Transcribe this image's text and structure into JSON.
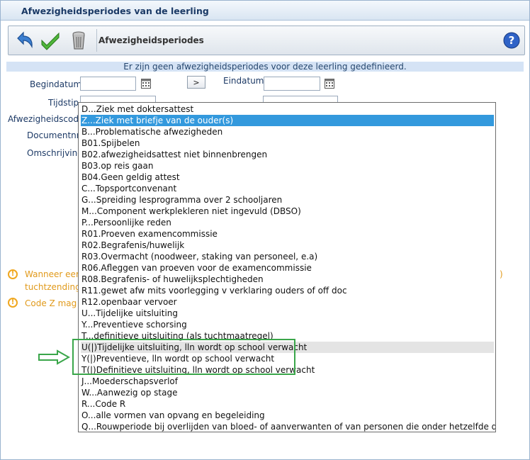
{
  "window": {
    "title": "Afwezigheidsperiodes van de leerling"
  },
  "toolbar": {
    "title": "Afwezigheidsperiodes",
    "icons": [
      "undo-icon",
      "checkmark-icon",
      "trash-icon",
      "help-icon"
    ]
  },
  "notice": "Er zijn geen afwezigheidsperiodes voor deze leerling gedefinieerd.",
  "form": {
    "begindatum_label": "Begindatum",
    "einddatum_label": "Eindatum",
    "range_button": ">",
    "tijdstip_label": "Tijdstip",
    "afwezigheidscode_label": "Afwezigheidscode",
    "documentnr_label": "Documentnr.",
    "omschrijving_label": "Omschrijving"
  },
  "warnings": {
    "line1": "Wanneer eer",
    "line1b": "tuchtzending",
    "line1_right": ")",
    "line2": "Code Z mag"
  },
  "dropdown": {
    "selected_index": 1,
    "hover_index": 21,
    "items": [
      "D...Ziek met doktersattest",
      "Z...Ziek met briefje van de ouder(s)",
      "B...Problematische afwezigheden",
      "B01.Spijbelen",
      "B02.afwezigheidsattest niet binnenbrengen",
      "B03.op reis gaan",
      "B04.Geen geldig attest",
      "C...Topsportconvenant",
      "G...Spreiding lesprogramma over 2 schooljaren",
      "M...Component werkplekleren niet ingevuld (DBSO)",
      "P...Persoonlijke reden",
      "R01.Proeven examencommissie",
      "R02.Begrafenis/huwelijk",
      "R03.Overmacht (noodweer, staking van personeel, e.a)",
      "R06.Afleggen van proeven voor de examencommissie",
      "R08.Begrafenis- of huwelijksplechtigheden",
      "R11.gewet afw mits voorlegging v verklaring ouders of off doc",
      "R12.openbaar vervoer",
      "U...Tijdelijke uitsluiting",
      "Y...Preventieve schorsing",
      "T...definitieve uitsluiting (als tuchtmaatregel)",
      "U(|)Tijdelijke uitsluiting, lln wordt op school verwacht",
      "Y(|)Preventieve, lln wordt op school verwacht",
      "T(|)Definitieve uitsluiting, lln wordt op school verwacht",
      "J...Moederschapsverlof",
      "W...Aanwezig op stage",
      "R...Code R",
      "O...alle vormen van opvang en begeleiding",
      "Q...Rouwperiode bij overlijden van bloed- of aanverwanten of van personen die onder hetzelfde dak wonen"
    ]
  },
  "colors": {
    "selected_bg": "#3399dd",
    "hover_bg": "#e4e4e4",
    "highlight_box": "#3aa64a",
    "warning": "#e19a1b"
  }
}
